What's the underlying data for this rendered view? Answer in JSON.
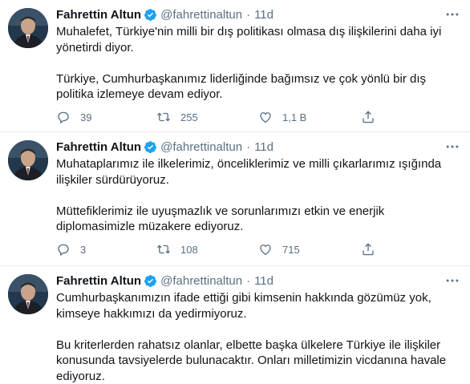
{
  "tweets": [
    {
      "display_name": "Fahrettin Altun",
      "handle": "@fahrettinaltun",
      "separator": "·",
      "time": "11d",
      "paragraphs": [
        "Muhalefet, Türkiye'nin milli bir dış politikası olmasa dış ilişkilerini daha iyi yönetirdi diyor.",
        "Türkiye, Cumhurbaşkanımız liderliğinde bağımsız ve çok yönlü bir dış politika izlemeye devam ediyor."
      ],
      "replies": "39",
      "retweets": "255",
      "likes": "1,1 B"
    },
    {
      "display_name": "Fahrettin Altun",
      "handle": "@fahrettinaltun",
      "separator": "·",
      "time": "11d",
      "paragraphs": [
        "Muhataplarımız ile ilkelerimiz, önceliklerimiz ve milli çıkarlarımız ışığında ilişkiler sürdürüyoruz.",
        "Müttefiklerimiz ile uyuşmazlık ve sorunlarımızı etkin ve enerjik diplomasimizle müzakere ediyoruz."
      ],
      "replies": "3",
      "retweets": "108",
      "likes": "715"
    },
    {
      "display_name": "Fahrettin Altun",
      "handle": "@fahrettinaltun",
      "separator": "·",
      "time": "11d",
      "paragraphs": [
        "Cumhurbaşkanımızın ifade ettiği gibi kimsenin hakkında gözümüz yok, kimseye hakkımızı da yedirmiyoruz.",
        "Bu kriterlerden rahatsız olanlar, elbette başka ülkelere Türkiye ile ilişkiler konusunda tavsiyelerde bulunacaktır. Onları milletimizin vicdanına havale ediyoruz."
      ]
    }
  ],
  "colors": {
    "text": "#0f1419",
    "secondary": "#5b7083",
    "verified": "#1da1f2",
    "divider": "#e6ecf0"
  },
  "icons": {
    "reply": "reply-icon",
    "retweet": "retweet-icon",
    "like": "heart-icon",
    "share": "share-icon",
    "verified": "verified-badge-icon",
    "more": "more-options-icon"
  }
}
